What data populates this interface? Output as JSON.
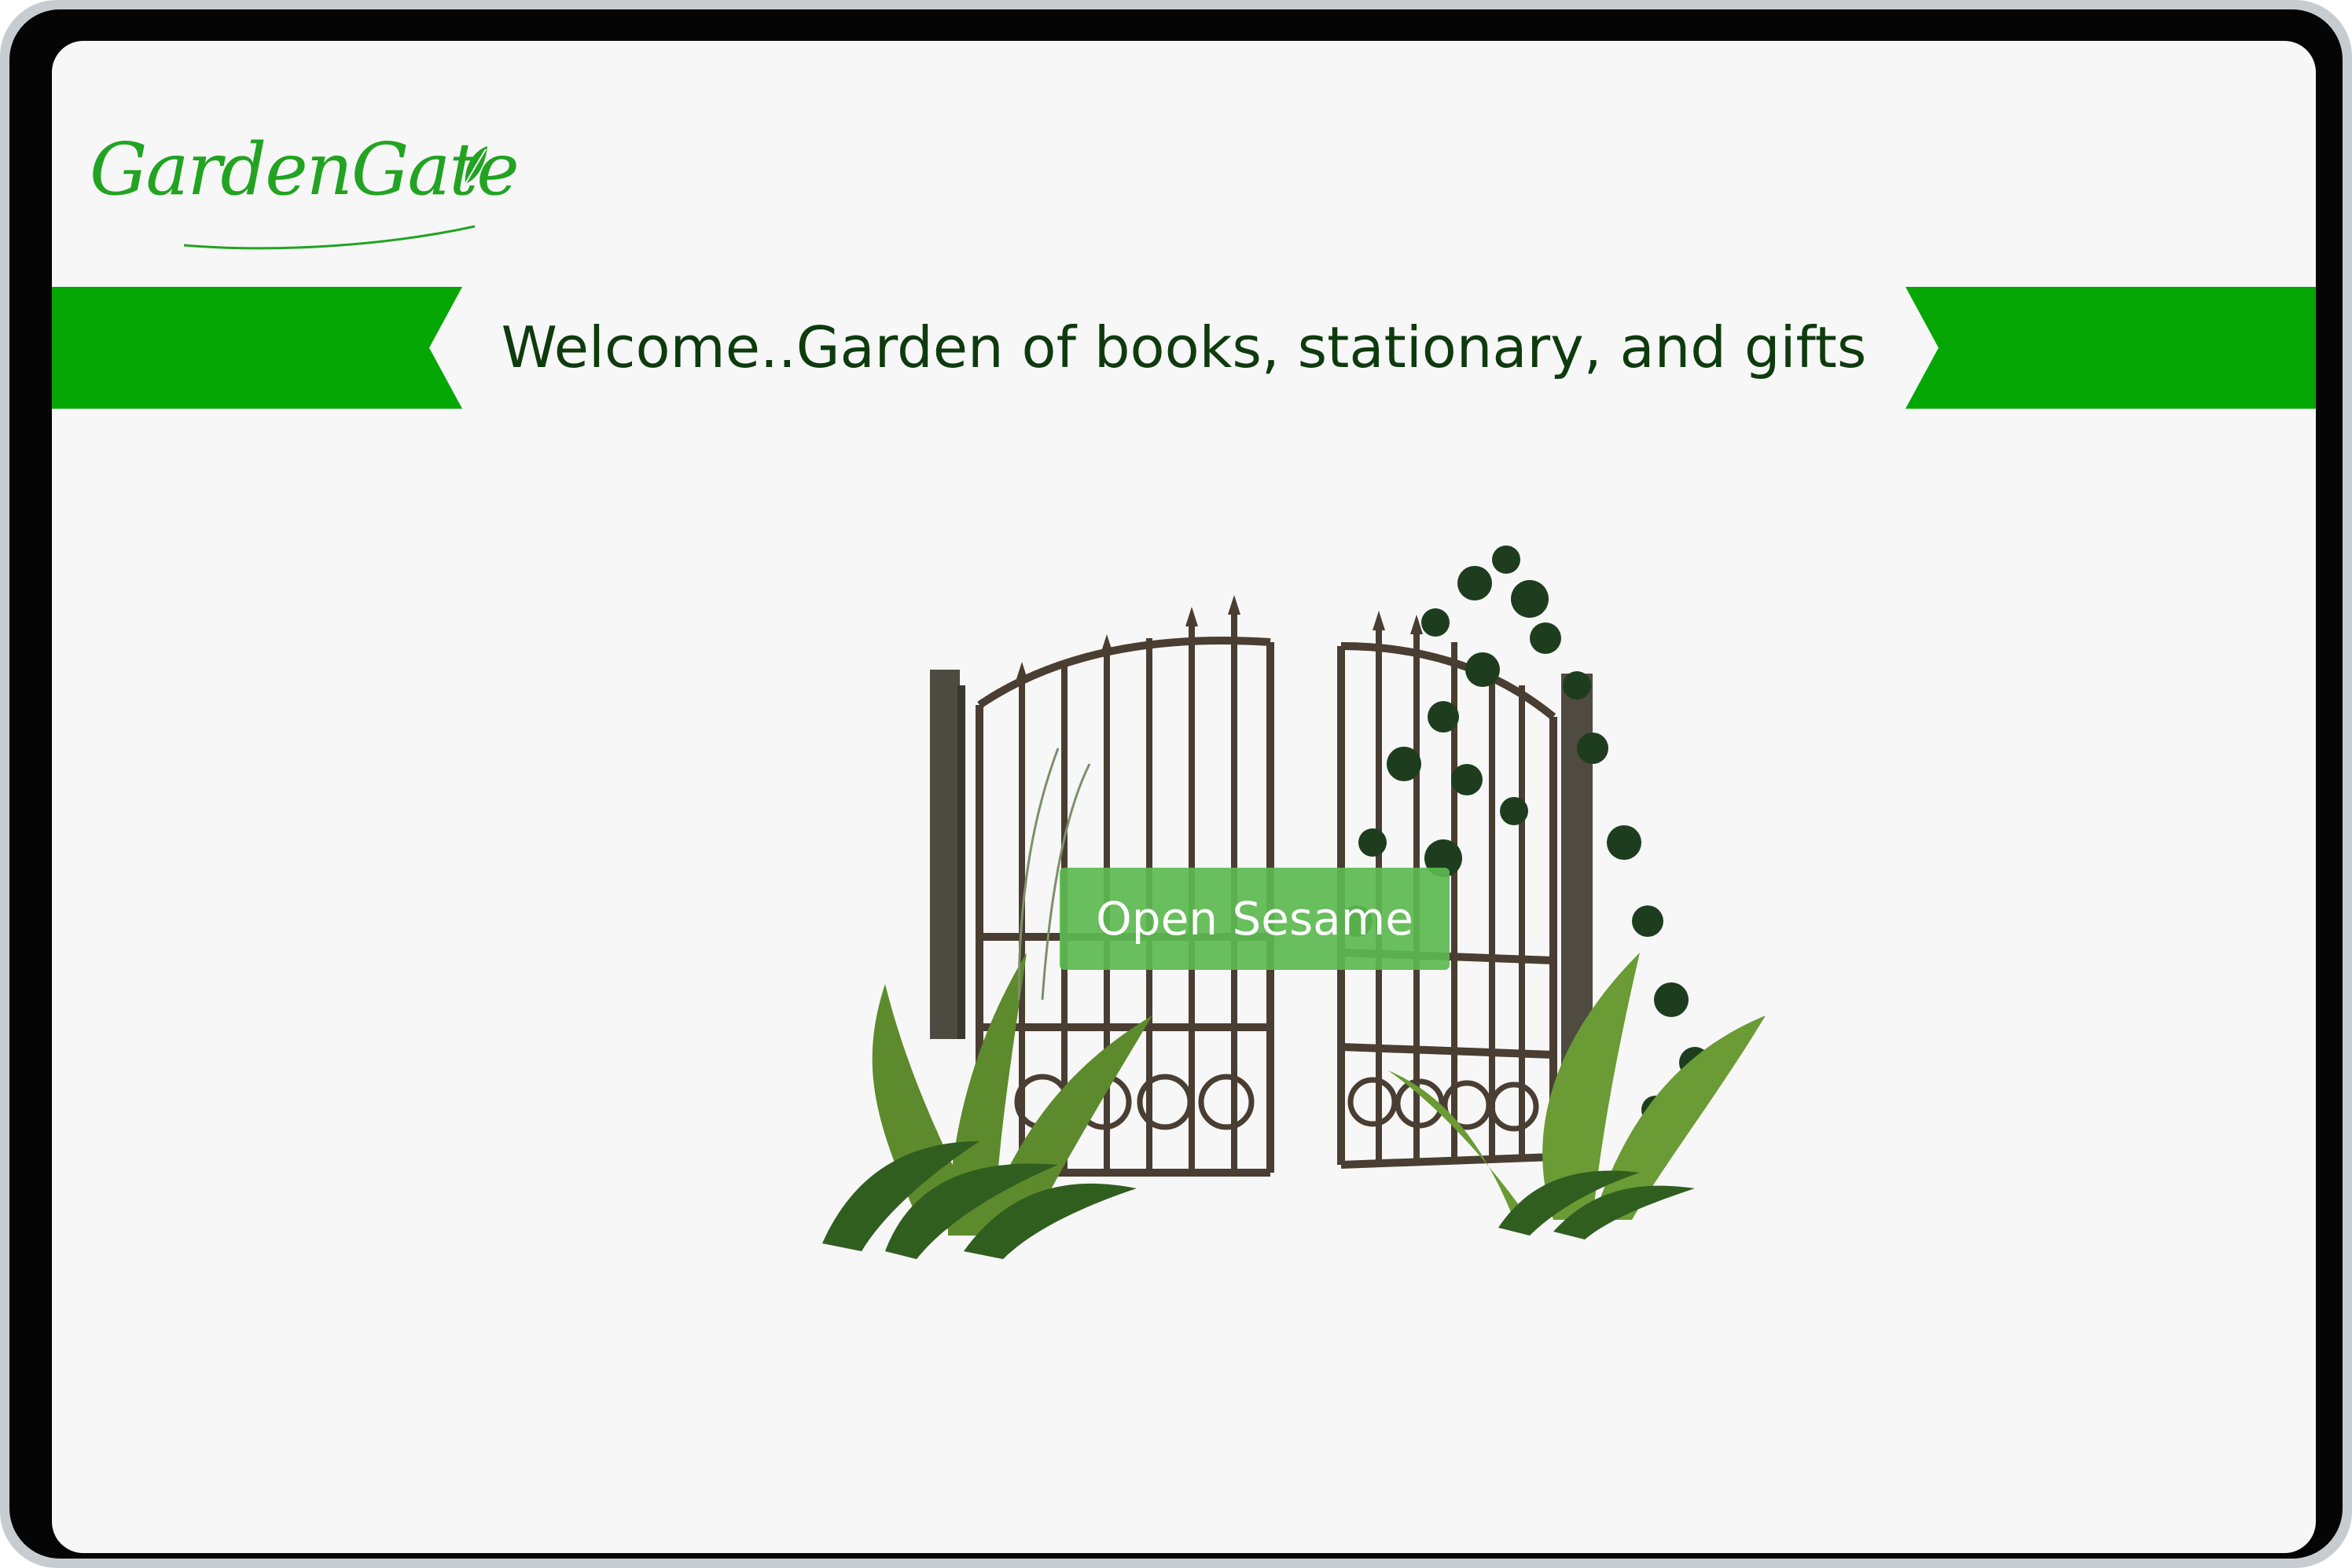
{
  "logo": {
    "text": "GardenGate"
  },
  "banner": {
    "title": "Welcome..Garden of books, stationary, and gifts"
  },
  "cta": {
    "label": "Open Sesame"
  },
  "colors": {
    "brand_green": "#04a704",
    "logo_green": "#22a322",
    "title_text": "#0e3b0e",
    "button_bg": "#5cb950",
    "screen_bg": "#f7f7f7"
  },
  "icons": {
    "logo_leaf": "leaf-icon",
    "hero": "garden-gate-illustration"
  }
}
